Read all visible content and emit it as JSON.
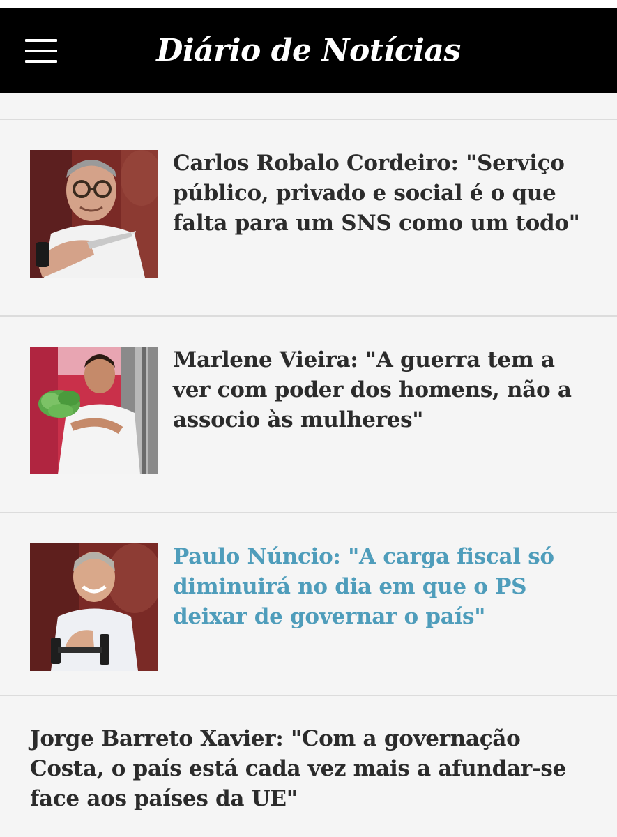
{
  "header": {
    "logo_text": "Diário de Notícias",
    "menu_icon": "hamburger-menu-icon",
    "background": "#000000"
  },
  "articles": [
    {
      "headline": "Carlos Robalo Cordeiro: \"Serviço público, privado e social é o que falta para um SNS como um todo\"",
      "image": "portrait-man-glasses-knife",
      "state": "default"
    },
    {
      "headline": "Marlene Vieira: \"A guerra tem a ver com poder dos homens, não a associo às mulheres\"",
      "image": "portrait-woman-chef-lettuce",
      "state": "default"
    },
    {
      "headline": "Paulo Núncio: \"A carga fiscal só diminuirá no dia em que o PS deixar de governar o país\"",
      "image": "portrait-man-dumbbell",
      "state": "visited"
    },
    {
      "headline": "Jorge Barreto Xavier: \"Com a governação Costa, o país está cada vez mais a afundar-se face aos países da UE\"",
      "image": null,
      "state": "default"
    }
  ],
  "colors": {
    "page_background": "#f5f5f5",
    "headline_text": "#2b2b2b",
    "visited_headline_text": "#4f9dbb",
    "divider": "#dcdcdc"
  }
}
